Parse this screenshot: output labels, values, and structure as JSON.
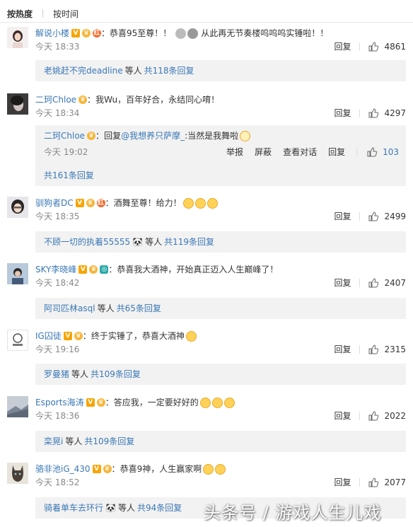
{
  "sort": {
    "by_hot": "按热度",
    "by_time": "按时间"
  },
  "actions": {
    "reply": "回复",
    "report": "举报",
    "block": "屏蔽",
    "view_convo": "查看对话"
  },
  "comments": [
    {
      "user": "解说小楼",
      "text": "恭喜95至尊！！",
      "text2": "从此再无节奏楼呜呜呜实锤啦！！",
      "time": "今天 18:33",
      "likes": "4861",
      "sub_user": "老姚赶不完deadline",
      "sub_others": "等人",
      "sub_count": "共118条回复"
    },
    {
      "user": "二珂Chloe",
      "text": "我Wu，百年好合，永结同心唷！",
      "time": "今天 18:34",
      "likes": "4297",
      "nested": {
        "user": "二珂Chloe",
        "reply_prefix": "回复",
        "mention": "@我想养只萨摩_",
        "text": ":当然是我舞啦",
        "time": "今天 19:02",
        "likes": "103",
        "total": "共161条回复"
      }
    },
    {
      "user": "驯狗者DC",
      "text": "酒舞至尊！给力！",
      "time": "今天 18:35",
      "likes": "2499",
      "sub_user": "不顾一切的执着55555",
      "sub_others": "等人",
      "sub_count": "共119条回复"
    },
    {
      "user": "SKY李晓峰",
      "text": "恭喜我大酒神，开始真正迈入人生巅峰了！",
      "time": "今天 18:42",
      "likes": "2407",
      "sub_user": "阿司匹林asql",
      "sub_others": "等人",
      "sub_count": "共65条回复"
    },
    {
      "user": "IG囚徒",
      "text": "终于实锤了，恭喜大酒神",
      "time": "今天 19:16",
      "likes": "2315",
      "sub_user": "罗曼猪",
      "sub_others": "等人",
      "sub_count": "共109条回复"
    },
    {
      "user": "Esports海涛",
      "text": "答应我，一定要好好的",
      "time": "今天 18:36",
      "likes": "2022",
      "sub_user": "栾晃i",
      "sub_others": "等人",
      "sub_count": "共109条回复"
    },
    {
      "user": "骆非池iG_430",
      "text": "恭喜9神，人生赢家啊",
      "time": "今天 18:52",
      "likes": "2077",
      "sub_user": "骑着单车去环行",
      "sub_others": "等人",
      "sub_count": "共94条回复"
    }
  ],
  "badges": {
    "vip_text": "V",
    "shop_text": "红"
  },
  "watermark": "头条号 / 游戏人生儿戏",
  "colors": {
    "link": "#3a78b5",
    "vip": "#f7a500",
    "sub_bg": "#f2f2f2",
    "timestamp": "#888888"
  },
  "icons": {
    "like": "thumbs-up-icon",
    "emoji": "smiley-emoji-icon"
  }
}
